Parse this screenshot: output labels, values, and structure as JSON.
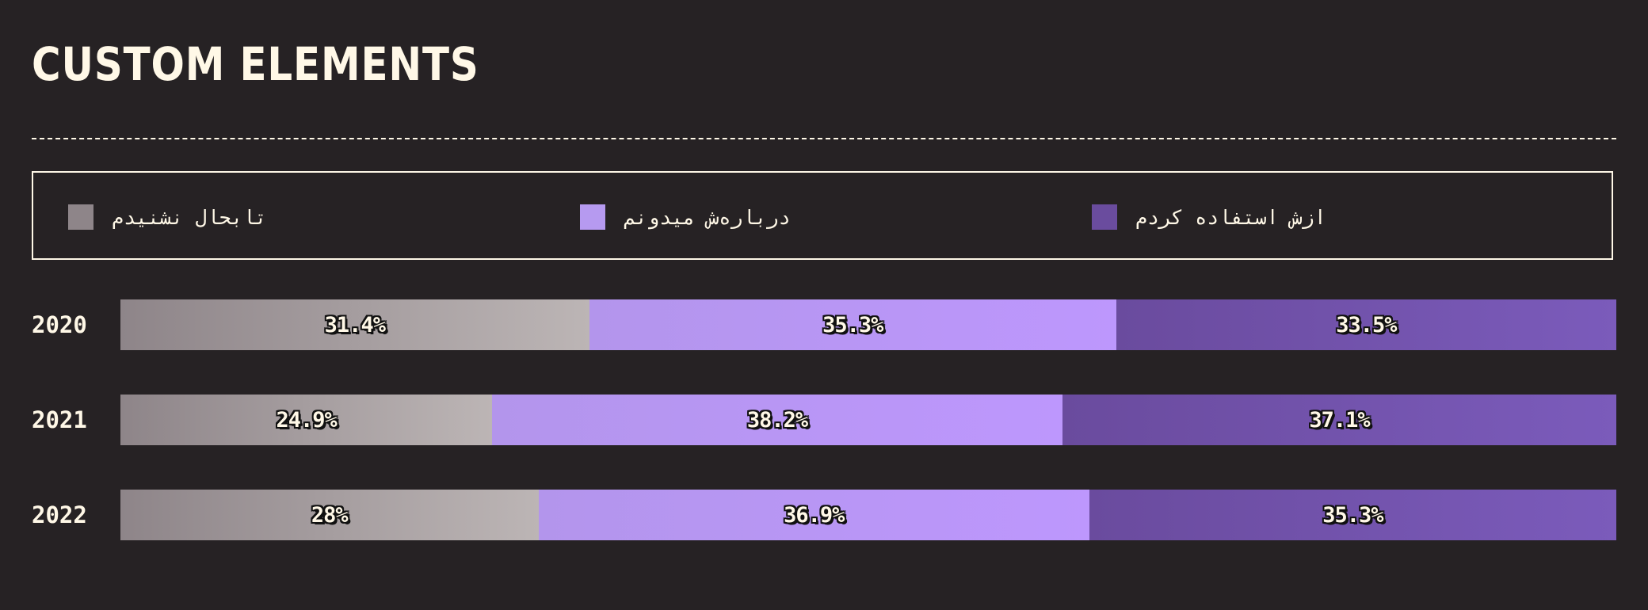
{
  "page": {
    "title": "CUSTOM ELEMENTS",
    "background": "#262224",
    "text_color": "#FFF8E7"
  },
  "legend": [
    {
      "label": "تابحال نشنیدم",
      "color": "#8E8589"
    },
    {
      "label": "درباره‌ش میدونم",
      "color": "#B69AF0"
    },
    {
      "label": "ازش استفاده کردم",
      "color": "#6A4C9E"
    }
  ],
  "chart_data": {
    "type": "bar",
    "orientation": "horizontal",
    "stacked": true,
    "normalized_percent": true,
    "categories": [
      "2020",
      "2021",
      "2022"
    ],
    "series": [
      {
        "name": "تابحال نشنیدم",
        "values": [
          31.4,
          24.9,
          28
        ],
        "labels": [
          "31.4%",
          "24.9%",
          "28%"
        ],
        "gradient": [
          "#8E8589",
          "#BCB5B5"
        ]
      },
      {
        "name": "درباره‌ش میدونم",
        "values": [
          35.3,
          38.2,
          36.9
        ],
        "labels": [
          "35.3%",
          "38.2%",
          "36.9%"
        ],
        "gradient": [
          "#B395EC",
          "#BD97FD"
        ]
      },
      {
        "name": "ازش استفاده کردم",
        "values": [
          33.5,
          37.1,
          35.3
        ],
        "labels": [
          "33.5%",
          "37.1%",
          "35.3%"
        ],
        "gradient": [
          "#6A4B9E",
          "#7B5BBB"
        ]
      }
    ],
    "xlim": [
      0,
      100
    ],
    "legend_position": "top",
    "grid": false
  }
}
